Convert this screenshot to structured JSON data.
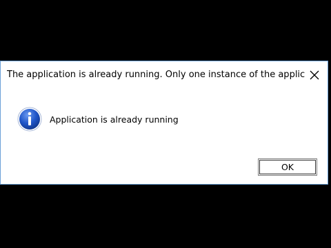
{
  "dialog": {
    "title": "The application is already running. Only one instance of the applicat...",
    "close_icon": "close-icon",
    "message_icon": "info-icon",
    "message": "Application is already running",
    "ok_label": "OK"
  },
  "colors": {
    "background": "#000000",
    "dialog_background": "#ffffff",
    "dialog_border": "#6aa0d8",
    "info_icon_blue": "#1f55c8"
  }
}
